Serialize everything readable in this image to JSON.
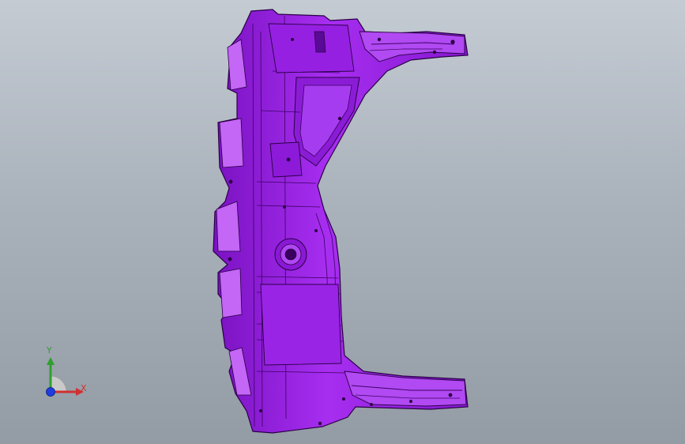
{
  "viewport": {
    "background_top": "#c4cbd3",
    "background_bottom": "#939ba5"
  },
  "model": {
    "part_color": "#9b1ee0",
    "part_shade": "#6a0fa8",
    "part_highlight": "#c566f5",
    "edge_color": "#2a0046"
  },
  "triad": {
    "y_label": "Y",
    "x_label": "X",
    "y_color": "#2fa02f",
    "x_color": "#d03030",
    "z_color": "#1e3ce0"
  }
}
